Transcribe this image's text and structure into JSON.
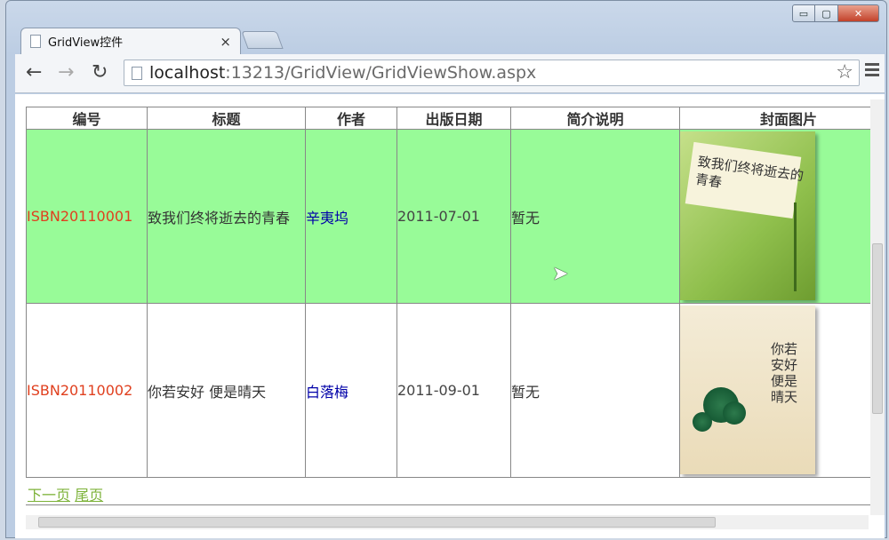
{
  "tab": {
    "title": "GridView控件",
    "close": "×"
  },
  "window_controls": {
    "minimize": "▭",
    "maximize": "▢",
    "close": "✕"
  },
  "nav": {
    "back": "←",
    "forward": "→",
    "reload": "↻",
    "star": "☆"
  },
  "address": {
    "host": "localhost",
    "rest": ":13213/GridView/GridViewShow.aspx"
  },
  "grid": {
    "headers": [
      "编号",
      "标题",
      "作者",
      "出版日期",
      "简介说明",
      "封面图片"
    ],
    "rows": [
      {
        "isbn": "ISBN20110001",
        "title": "致我们终将逝去的青春",
        "author": "辛夷坞",
        "date": "2011-07-01",
        "desc": "暂无",
        "cover_text": "致我们终将逝去的青春"
      },
      {
        "isbn": "ISBN20110002",
        "title": "你若安好 便是晴天",
        "author": "白落梅",
        "date": "2011-09-01",
        "desc": "暂无",
        "cover_text": "你若安好便是晴天"
      }
    ]
  },
  "pager": {
    "next": "下一页",
    "last": "尾页"
  },
  "colors": {
    "selected_row": "#98fb98",
    "isbn": "#e0401f",
    "author": "#0000a8",
    "pager_link": "#7cb238"
  }
}
